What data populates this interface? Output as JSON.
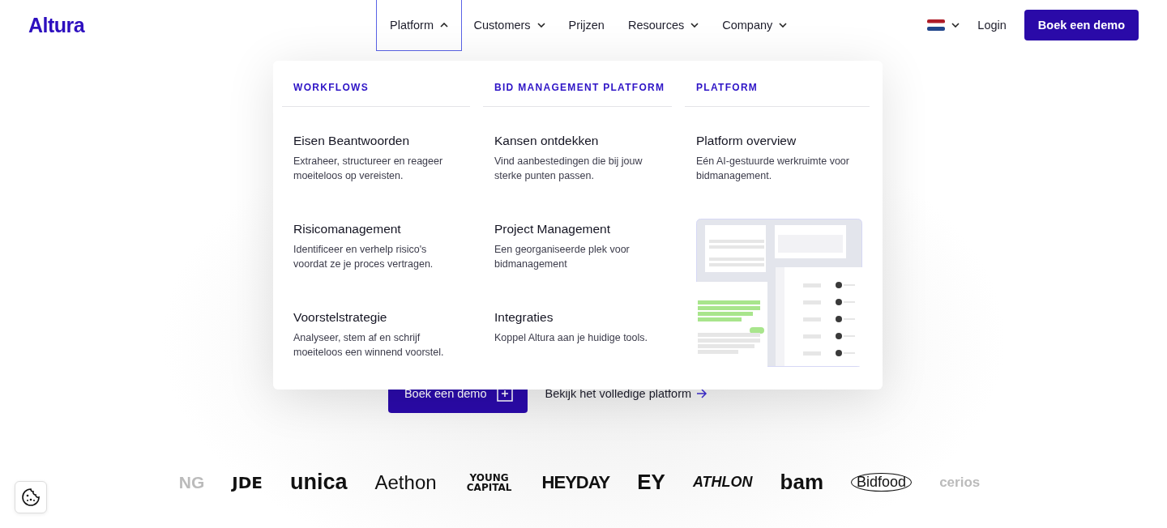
{
  "brand": "Altura",
  "nav": [
    {
      "label": "Platform",
      "has_menu": true,
      "expanded": true
    },
    {
      "label": "Customers",
      "has_menu": true,
      "expanded": false
    },
    {
      "label": "Prijzen",
      "has_menu": false,
      "expanded": false
    },
    {
      "label": "Resources",
      "has_menu": true,
      "expanded": false
    },
    {
      "label": "Company",
      "has_menu": true,
      "expanded": false
    }
  ],
  "login": "Login",
  "demo_button": "Boek een demo",
  "menu": {
    "columns": [
      {
        "heading": "WORKFLOWS",
        "items": [
          {
            "title": "Eisen Beantwoorden",
            "description": "Extraheer, structureer en reageer moeiteloos op vereisten."
          },
          {
            "title": "Risicomanagement",
            "description": "Identificeer en verhelp risico's voordat ze je proces vertragen."
          },
          {
            "title": "Voorstelstrategie",
            "description": "Analyseer, stem af en schrijf moeiteloos een winnend voorstel."
          }
        ]
      },
      {
        "heading": "BID MANAGEMENT PLATFORM",
        "items": [
          {
            "title": "Kansen ontdekken",
            "description": "Vind aanbestedingen die bij jouw sterke punten passen."
          },
          {
            "title": "Project Management",
            "description": "Een georganiseerde plek voor bidmanagement"
          },
          {
            "title": "Integraties",
            "description": "Koppel Altura aan je huidige tools."
          }
        ]
      },
      {
        "heading": "PLATFORM",
        "items": [
          {
            "title": "Platform overview",
            "description": "Eén AI-gestuurde werkruimte voor bidmanagement."
          }
        ],
        "preview": true
      }
    ]
  },
  "hero": {
    "demo_button": "Boek een demo",
    "platform_link": "Bekijk het volledige platform"
  },
  "logos": [
    {
      "text": "NG",
      "faded": true
    },
    {
      "text": "JDE",
      "faded": false
    },
    {
      "text": "unica",
      "faded": false
    },
    {
      "text": "Aethon",
      "faded": false
    },
    {
      "text": "YOUNG CAPITAL",
      "faded": false
    },
    {
      "text": "HEYDAY",
      "faded": false
    },
    {
      "text": "EY",
      "faded": false
    },
    {
      "text": "ATHLON",
      "faded": false
    },
    {
      "text": "bam",
      "faded": false
    },
    {
      "text": "Bidfood",
      "faded": false
    },
    {
      "text": "cerios",
      "faded": true
    }
  ]
}
